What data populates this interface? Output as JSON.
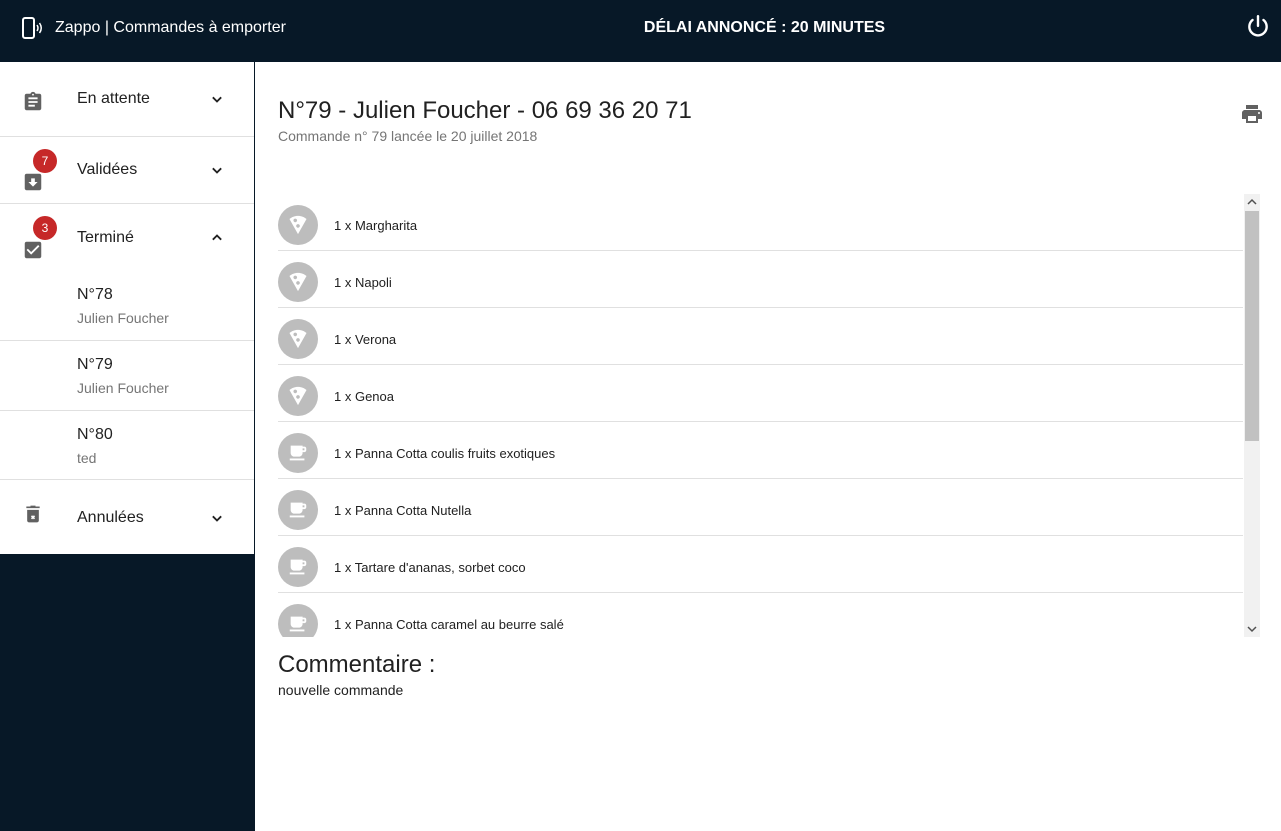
{
  "header": {
    "app_title": "Zappo | Commandes à emporter",
    "delay_text": "DÉLAI ANNONCÉ : 20 MINUTES",
    "icon_app": "phone-ringing-icon",
    "icon_power": "power-icon"
  },
  "sidebar": {
    "sections": {
      "pending": {
        "label": "En attente",
        "icon": "clipboard-icon",
        "expanded": false
      },
      "validated": {
        "label": "Validées",
        "icon": "inbox-download-icon",
        "badge": "7",
        "expanded": false
      },
      "done": {
        "label": "Terminé",
        "icon": "check-box-icon",
        "badge": "3",
        "expanded": true
      },
      "cancelled": {
        "label": "Annulées",
        "icon": "trash-icon",
        "expanded": false
      }
    },
    "done_orders": [
      {
        "number": "N°78",
        "customer": "Julien Foucher"
      },
      {
        "number": "N°79",
        "customer": "Julien Foucher"
      },
      {
        "number": "N°80",
        "customer": "ted"
      }
    ]
  },
  "order": {
    "title": "N°79 - Julien Foucher - 06 69 36 20 71",
    "subtitle": "Commande n° 79 lancée le 20 juillet 2018",
    "items": [
      {
        "text": "1 x Margharita",
        "icon": "pizza-icon"
      },
      {
        "text": "1 x Napoli",
        "icon": "pizza-icon"
      },
      {
        "text": "1 x Verona",
        "icon": "pizza-icon"
      },
      {
        "text": "1 x Genoa",
        "icon": "pizza-icon"
      },
      {
        "text": "1 x Panna Cotta coulis fruits exotiques",
        "icon": "dessert-cup-icon"
      },
      {
        "text": "1 x Panna Cotta Nutella",
        "icon": "dessert-cup-icon"
      },
      {
        "text": "1 x Tartare d'ananas, sorbet coco",
        "icon": "dessert-cup-icon"
      },
      {
        "text": "1 x Panna Cotta caramel au beurre salé",
        "icon": "dessert-cup-icon"
      }
    ],
    "comment_heading": "Commentaire :",
    "comment_text": "nouvelle commande"
  },
  "colors": {
    "background_dark": "#071827",
    "badge_red": "#c62828",
    "icon_grey": "#616161",
    "avatar_grey": "#bdbdbd"
  }
}
